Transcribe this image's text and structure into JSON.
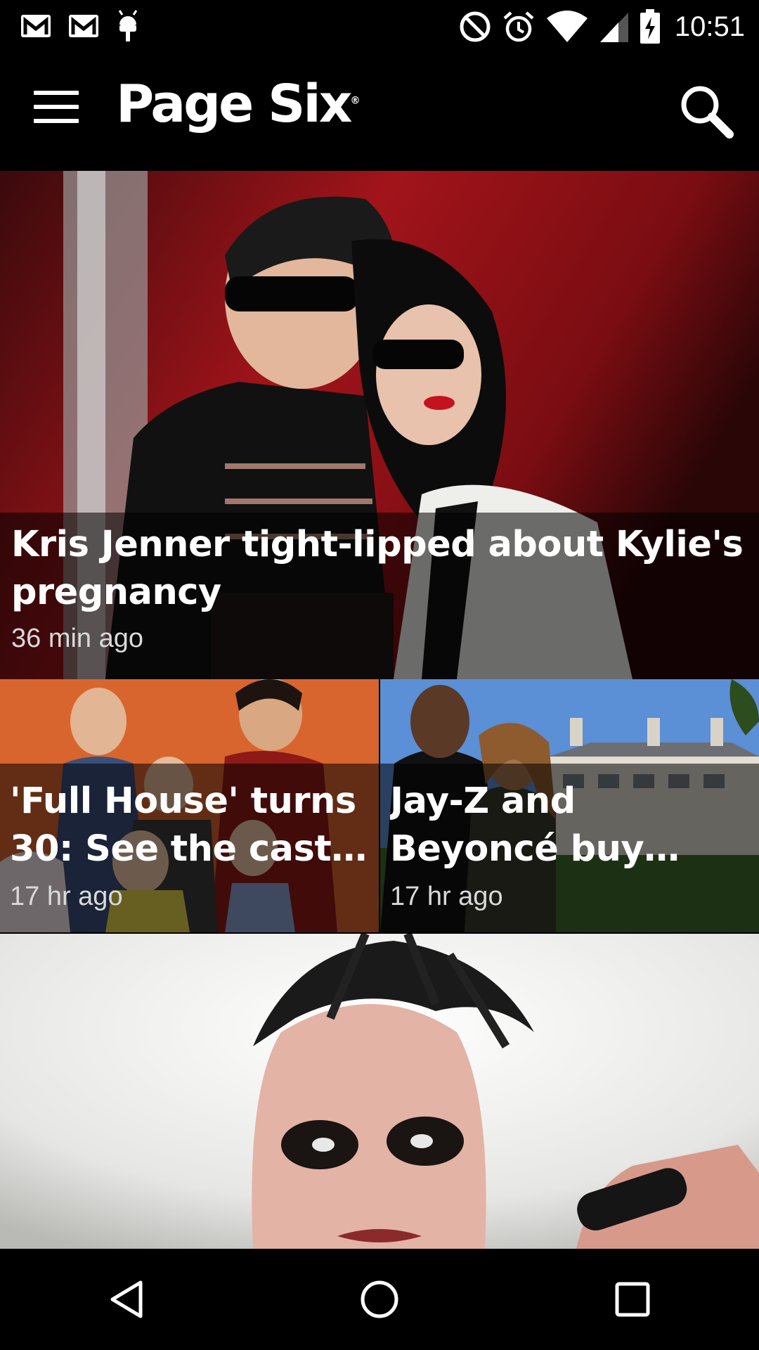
{
  "status_bar": {
    "time": "10:51",
    "left_icons": [
      "gmail-icon",
      "gmail-icon",
      "android-debug-icon"
    ],
    "right_icons": [
      "do-not-disturb-icon",
      "alarm-icon",
      "wifi-icon",
      "signal-icon",
      "battery-charging-icon"
    ]
  },
  "app_bar": {
    "brand": "Page Six",
    "brand_mark": "®",
    "menu_icon": "hamburger-menu-icon",
    "search_icon": "search-icon"
  },
  "articles": [
    {
      "title": "Kris Jenner tight-lipped about Kylie's pregnancy",
      "time": "36 min ago"
    },
    {
      "title_line1": "'Full House' turns",
      "title_line2": "30: See the cast…",
      "time": "17 hr ago"
    },
    {
      "title_line1": "Jay-Z and",
      "title_line2": "Beyoncé buy…",
      "time": "17 hr ago"
    }
  ],
  "nav_bar": {
    "icons": [
      "back-icon",
      "home-icon",
      "recents-icon"
    ]
  },
  "colors": {
    "background": "#000000",
    "overlay": "rgba(0,0,0,0.55)",
    "text": "#ffffff",
    "subtext": "#d9d9d9"
  }
}
